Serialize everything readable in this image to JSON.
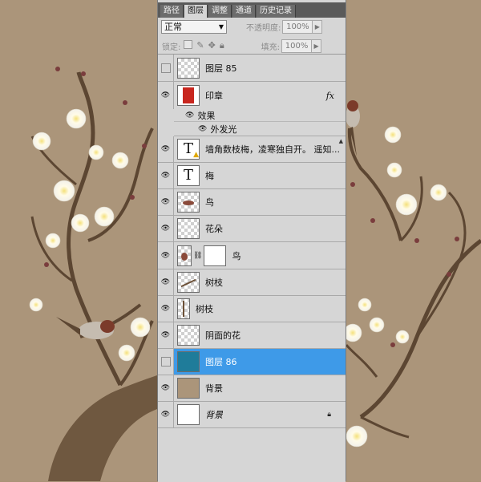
{
  "panel": {
    "tabs": [
      "路径",
      "图层",
      "调整",
      "通道",
      "历史记录"
    ],
    "active_tab": "图层",
    "blend_mode": "正常",
    "opacity_label": "不透明度:",
    "opacity_value": "100%",
    "lock_label": "锁定:",
    "fill_label": "填充:",
    "fill_value": "100%"
  },
  "layers": [
    {
      "name": "图层 85",
      "visible": false,
      "thumb": "checker"
    },
    {
      "name": "印章",
      "visible": true,
      "thumb": "seal",
      "fx": "fx",
      "effects_label": "效果",
      "effect_item": "外发光"
    },
    {
      "name": "墙角数枝梅，凌寒独自开。 遥知...",
      "visible": true,
      "thumb": "text-warning"
    },
    {
      "name": "梅",
      "visible": true,
      "thumb": "text"
    },
    {
      "name": "鸟",
      "visible": true,
      "thumb": "bird"
    },
    {
      "name": "花朵",
      "visible": true,
      "thumb": "checker"
    },
    {
      "name": "鸟",
      "visible": true,
      "thumb": "bird-mask"
    },
    {
      "name": "树枝",
      "visible": true,
      "thumb": "branch"
    },
    {
      "name": "树枝",
      "visible": true,
      "thumb": "branch2"
    },
    {
      "name": "阴面的花",
      "visible": true,
      "thumb": "checker"
    },
    {
      "name": "图层 86",
      "visible": false,
      "thumb": "teal",
      "selected": true
    },
    {
      "name": "背景",
      "visible": true,
      "thumb": "tan"
    },
    {
      "name": "背景",
      "visible": true,
      "thumb": "white",
      "locked": true,
      "italic": true
    }
  ],
  "colors": {
    "background": "#a99377",
    "selection": "#3e9ae8",
    "panel": "#d6d6d6"
  }
}
